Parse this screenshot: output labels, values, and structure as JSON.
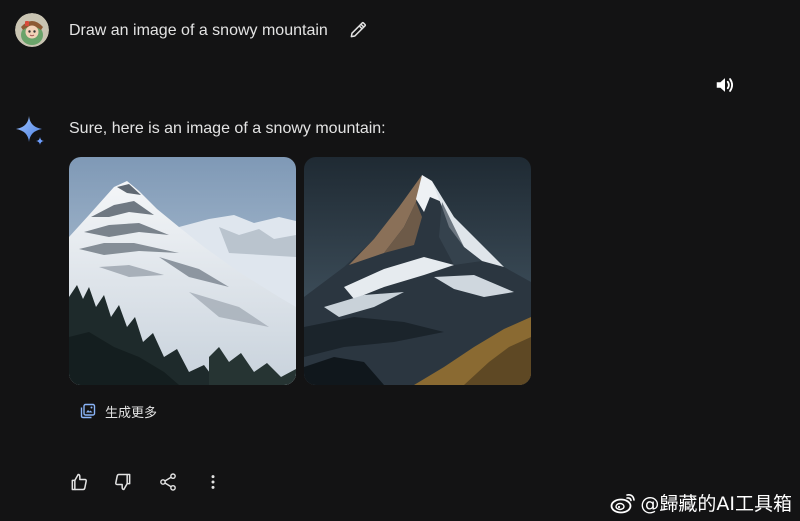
{
  "user_prompt": {
    "avatar_icon": "user-avatar-icon",
    "text": "Draw an image of a snowy mountain",
    "edit_icon": "pencil-icon"
  },
  "speaker_icon": "volume-icon",
  "response": {
    "icon": "gemini-sparkle-icon",
    "text": "Sure, here is an image of a snowy mountain:",
    "images": [
      {
        "subject": "snowy-mountain-image-1"
      },
      {
        "subject": "snowy-mountain-image-2"
      }
    ],
    "generate_more": {
      "icon": "generate-more-icon",
      "label": "生成更多"
    }
  },
  "actions": [
    {
      "icon": "thumbs-up-icon"
    },
    {
      "icon": "thumbs-down-icon"
    },
    {
      "icon": "share-icon"
    },
    {
      "icon": "more-vert-icon"
    }
  ],
  "watermark": {
    "icon": "weibo-logo-icon",
    "text": "@歸藏的AI工具箱"
  },
  "colors": {
    "background": "#131314",
    "text": "#e3e3e3",
    "accent_blue": "#8ab4f8"
  }
}
